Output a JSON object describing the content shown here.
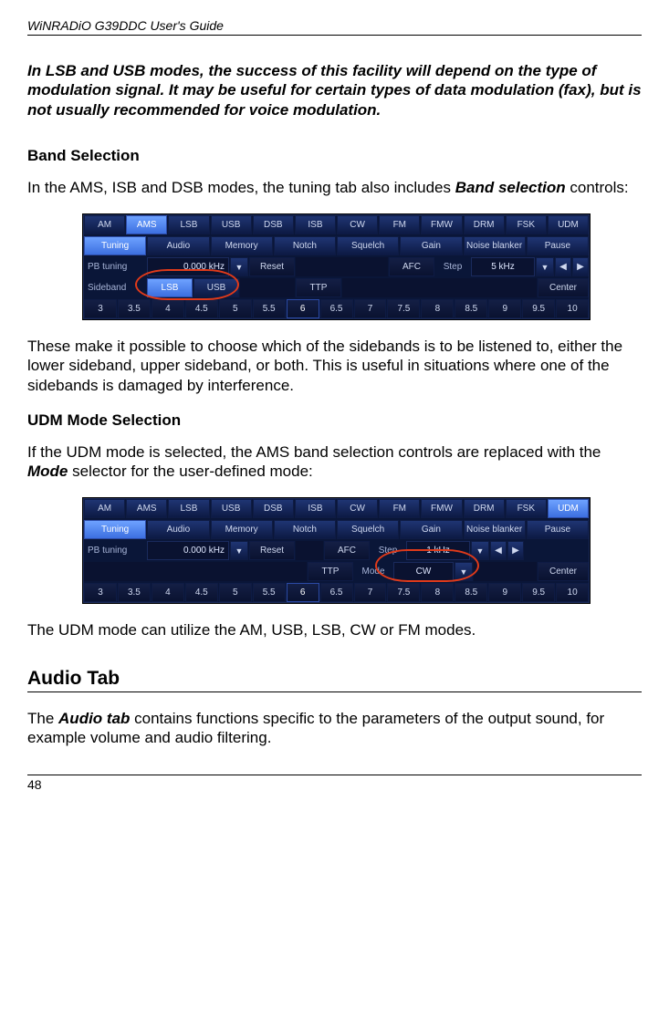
{
  "doc_title": "WiNRADiO G39DDC User's Guide",
  "note": "In LSB and USB modes, the success of this facility will depend on the type of modulation signal. It may be useful for certain types of data modulation (fax), but is not usually recommended for voice modulation.",
  "band_selection": {
    "heading": "Band Selection",
    "intro_pre": "In the AMS, ISB and DSB modes, the tuning tab also includes ",
    "intro_bold": "Band selection",
    "intro_post": " controls:",
    "after": "These make it possible to choose which of the sidebands is to be listened to, either the lower sideband, upper sideband, or both. This is useful in situations where one of the sidebands is damaged by interference."
  },
  "udm": {
    "heading": "UDM Mode Selection",
    "intro_pre": "If the UDM mode is selected, the AMS band selection controls are replaced with the ",
    "intro_bold": "Mode",
    "intro_post": " selector for the user-defined mode:",
    "after": "The UDM mode can utilize the AM, USB, LSB, CW or FM modes."
  },
  "audio": {
    "heading": "Audio Tab",
    "para_pre": "The ",
    "para_bold": "Audio tab",
    "para_post": " contains functions specific to the parameters of the output sound, for example volume and audio filtering."
  },
  "page_num": "48",
  "panel1": {
    "modes": [
      "AM",
      "AMS",
      "LSB",
      "USB",
      "DSB",
      "ISB",
      "CW",
      "FM",
      "FMW",
      "DRM",
      "FSK",
      "UDM"
    ],
    "active_mode_index": 1,
    "tabs": [
      "Tuning",
      "Audio",
      "Memory",
      "Notch",
      "Squelch",
      "Gain",
      "Noise blanker",
      "Pause"
    ],
    "active_tab_index": 0,
    "row3": {
      "pb_label": "PB tuning",
      "pb_value": "0.000 kHz",
      "reset": "Reset",
      "afc": "AFC",
      "step_label": "Step",
      "step_value": "5 kHz",
      "left": "◀",
      "right": "▶"
    },
    "row4": {
      "sideband_label": "Sideband",
      "lsb": "LSB",
      "usb": "USB",
      "ttp": "TTP",
      "center": "Center"
    },
    "ruler": [
      "3",
      "3.5",
      "4",
      "4.5",
      "5",
      "5.5",
      "6",
      "6.5",
      "7",
      "7.5",
      "8",
      "8.5",
      "9",
      "9.5",
      "10"
    ],
    "ruler_active_index": 6
  },
  "panel2": {
    "modes": [
      "AM",
      "AMS",
      "LSB",
      "USB",
      "DSB",
      "ISB",
      "CW",
      "FM",
      "FMW",
      "DRM",
      "FSK",
      "UDM"
    ],
    "active_mode_index": 11,
    "tabs": [
      "Tuning",
      "Audio",
      "Memory",
      "Notch",
      "Squelch",
      "Gain",
      "Noise blanker",
      "Pause"
    ],
    "active_tab_index": 0,
    "row3a": {
      "pb_label": "PB tuning",
      "pb_value": "0.000 kHz",
      "reset": "Reset",
      "afc": "AFC",
      "step_label": "Step",
      "step_value": "1 kHz",
      "left": "◀",
      "right": "▶"
    },
    "row3b": {
      "ttp": "TTP",
      "mode_label": "Mode",
      "mode_value": "CW",
      "center": "Center"
    },
    "ruler": [
      "3",
      "3.5",
      "4",
      "4.5",
      "5",
      "5.5",
      "6",
      "6.5",
      "7",
      "7.5",
      "8",
      "8.5",
      "9",
      "9.5",
      "10"
    ],
    "ruler_active_index": 6
  }
}
